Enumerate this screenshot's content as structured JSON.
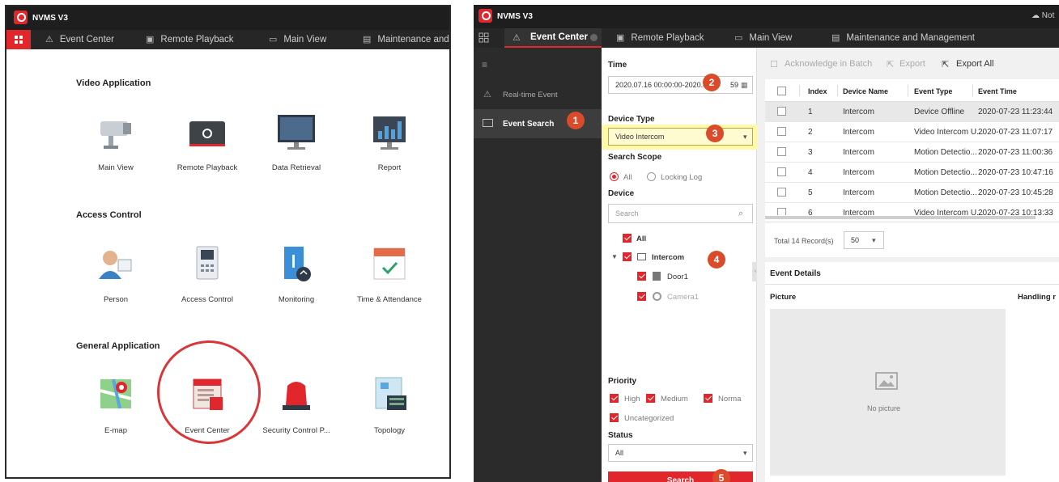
{
  "left": {
    "app_name": "NVMS V3",
    "nav": [
      {
        "label": "Event Center"
      },
      {
        "label": "Remote Playback"
      },
      {
        "label": "Main View"
      },
      {
        "label": "Maintenance and"
      }
    ],
    "groups": [
      {
        "title": "Video Application",
        "items": [
          "Main View",
          "Remote Playback",
          "Data Retrieval",
          "Report"
        ]
      },
      {
        "title": "Access Control",
        "items": [
          "Person",
          "Access Control",
          "Monitoring",
          "Time & Attendance"
        ]
      },
      {
        "title": "General Application",
        "items": [
          "E-map",
          "Event Center",
          "Security Control P...",
          "Topology"
        ]
      }
    ]
  },
  "right": {
    "app_name": "NVMS V3",
    "top_status": "Not",
    "nav": [
      {
        "label": "Event Center"
      },
      {
        "label": "Remote Playback"
      },
      {
        "label": "Main View"
      },
      {
        "label": "Maintenance and Management"
      }
    ],
    "sidebar": [
      {
        "label": "Real-time Event"
      },
      {
        "label": "Event Search"
      }
    ],
    "filter": {
      "time_label": "Time",
      "time_value": "2020.07.16 00:00:00-2020.07.2",
      "time_tail": "59",
      "device_type_label": "Device Type",
      "device_type_value": "Video Intercom",
      "search_scope_label": "Search Scope",
      "scope_all": "All",
      "scope_locking": "Locking Log",
      "device_label": "Device",
      "search_placeholder": "Search",
      "tree_all": "All",
      "tree_intercom": "Intercom",
      "tree_door": "Door1",
      "tree_camera": "Camera1",
      "priority_label": "Priority",
      "priority_high": "High",
      "priority_medium": "Medium",
      "priority_normal": "Norma",
      "priority_uncat": "Uncategorized",
      "status_label": "Status",
      "status_value": "All",
      "search_button": "Search"
    },
    "badges": [
      "1",
      "2",
      "3",
      "4",
      "5"
    ],
    "toolbar": {
      "ack": "Acknowledge in Batch",
      "export": "Export",
      "export_all": "Export All"
    },
    "table": {
      "headers": [
        "Index",
        "Device Name",
        "Event Type",
        "Event Time"
      ],
      "rows": [
        [
          "1",
          "Intercom",
          "Device Offline",
          "2020-07-23 11:23:44"
        ],
        [
          "2",
          "Intercom",
          "Video Intercom U...",
          "2020-07-23 11:07:17"
        ],
        [
          "3",
          "Intercom",
          "Motion Detectio...",
          "2020-07-23 11:00:36"
        ],
        [
          "4",
          "Intercom",
          "Motion Detectio...",
          "2020-07-23 10:47:16"
        ],
        [
          "5",
          "Intercom",
          "Motion Detectio...",
          "2020-07-23 10:45:28"
        ],
        [
          "6",
          "Intercom",
          "Video Intercom U...",
          "2020-07-23 10:13:33"
        ]
      ]
    },
    "pager": {
      "total": "Total 14 Record(s)",
      "page_size": "50"
    },
    "details": {
      "title": "Event Details",
      "picture_label": "Picture",
      "handling_label": "Handling r",
      "no_picture": "No picture"
    }
  }
}
